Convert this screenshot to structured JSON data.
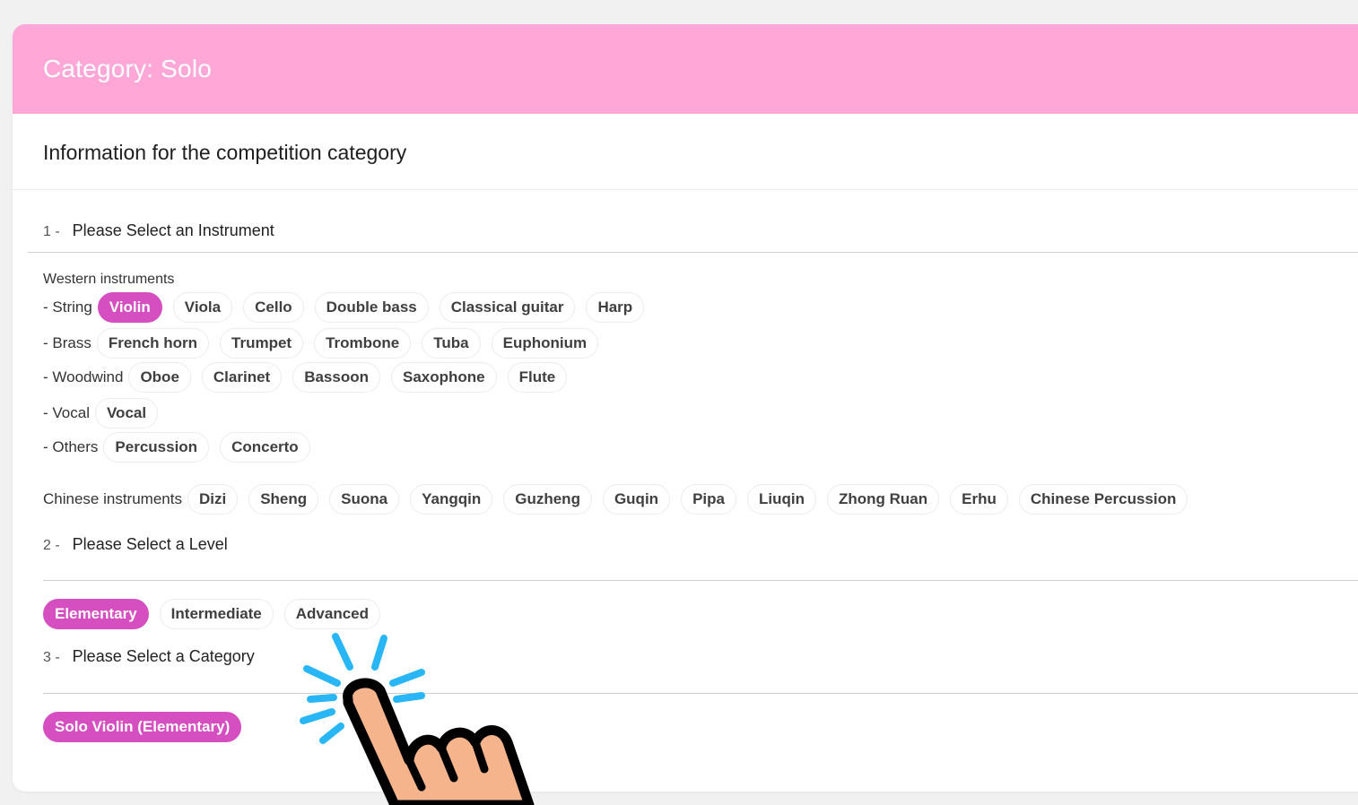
{
  "header": {
    "title": "Category: Solo"
  },
  "info_title": "Information for the competition category",
  "steps": [
    {
      "num": "1 -",
      "label": "Please Select an Instrument"
    },
    {
      "num": "2 -",
      "label": "Please Select a Level"
    },
    {
      "num": "3 -",
      "label": "Please Select a Category"
    }
  ],
  "western": {
    "title": "Western instruments",
    "string": {
      "label": "- String",
      "items": [
        "Violin",
        "Viola",
        "Cello",
        "Double bass",
        "Classical guitar",
        "Harp"
      ],
      "selected": "Violin"
    },
    "brass": {
      "label": "- Brass",
      "items": [
        "French horn",
        "Trumpet",
        "Trombone",
        "Tuba",
        "Euphonium"
      ]
    },
    "woodwind": {
      "label": "- Woodwind",
      "items": [
        "Oboe",
        "Clarinet",
        "Bassoon",
        "Saxophone",
        "Flute"
      ]
    },
    "vocal": {
      "label": "- Vocal",
      "items": [
        "Vocal"
      ]
    },
    "others": {
      "label": "- Others",
      "items": [
        "Percussion",
        "Concerto"
      ]
    }
  },
  "chinese": {
    "label": "Chinese instruments",
    "items": [
      "Dizi",
      "Sheng",
      "Suona",
      "Yangqin",
      "Guzheng",
      "Guqin",
      "Pipa",
      "Liuqin",
      "Zhong Ruan",
      "Erhu",
      "Chinese Percussion"
    ]
  },
  "levels": {
    "items": [
      "Elementary",
      "Intermediate",
      "Advanced"
    ],
    "selected": "Elementary"
  },
  "category": {
    "items": [
      "Solo Violin (Elementary)"
    ],
    "selected": "Solo Violin (Elementary)"
  },
  "colors": {
    "header_bg": "#ffa8d8",
    "accent": "#d54fc0",
    "page_bg": "#f1f1f1",
    "hand_fill": "#f5b48c",
    "spark": "#29b6f6"
  },
  "icons": {
    "pointer": "hand-pointer-icon"
  }
}
